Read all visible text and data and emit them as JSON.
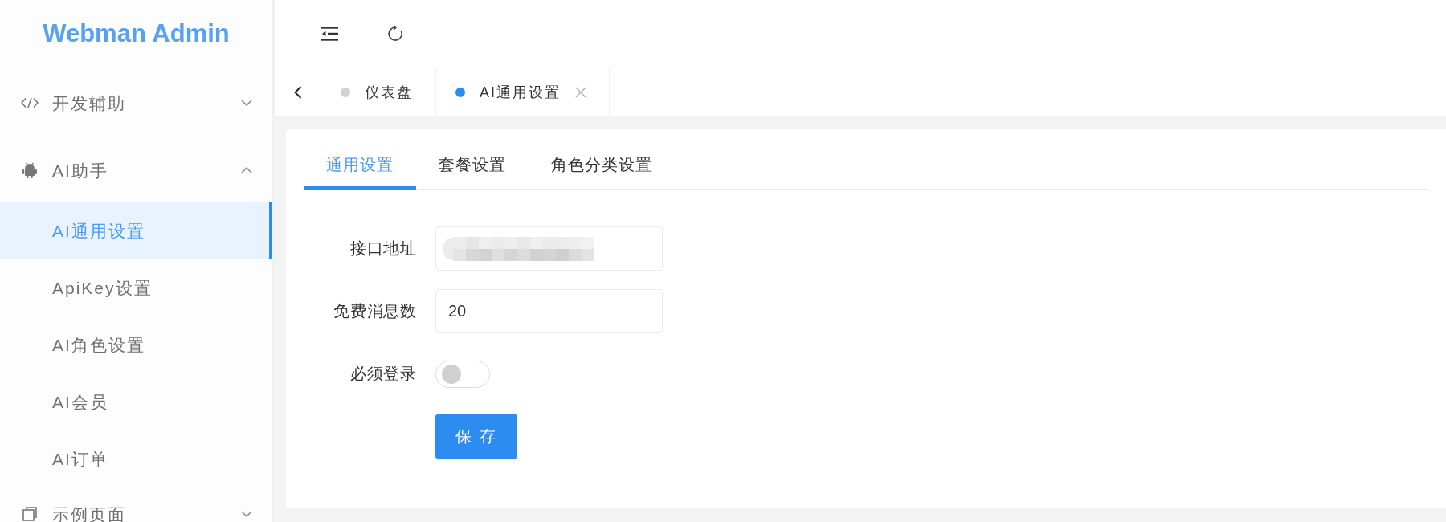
{
  "sidebar": {
    "logo": "Webman Admin",
    "menu": [
      {
        "label": "开发辅助",
        "expanded": false
      },
      {
        "label": "AI助手",
        "expanded": true,
        "children": [
          {
            "label": "AI通用设置",
            "selected": true
          },
          {
            "label": "ApiKey设置",
            "selected": false
          },
          {
            "label": "AI角色设置",
            "selected": false
          },
          {
            "label": "AI会员",
            "selected": false
          },
          {
            "label": "AI订单",
            "selected": false
          }
        ]
      },
      {
        "label": "示例页面",
        "expanded": false
      }
    ]
  },
  "page_tabs": [
    {
      "label": "仪表盘",
      "selected": false,
      "closable": false
    },
    {
      "label": "AI通用设置",
      "selected": true,
      "closable": true
    }
  ],
  "settings_tabs": [
    {
      "label": "通用设置",
      "selected": true
    },
    {
      "label": "套餐设置",
      "selected": false
    },
    {
      "label": "角色分类设置",
      "selected": false
    }
  ],
  "form": {
    "fields": [
      {
        "label": "接口地址",
        "kind": "text",
        "redacted": true
      },
      {
        "label": "免费消息数",
        "kind": "text",
        "redacted": false,
        "value": "20"
      },
      {
        "label": "必须登录",
        "kind": "switch",
        "on": false
      }
    ],
    "submit": "保 存"
  }
}
